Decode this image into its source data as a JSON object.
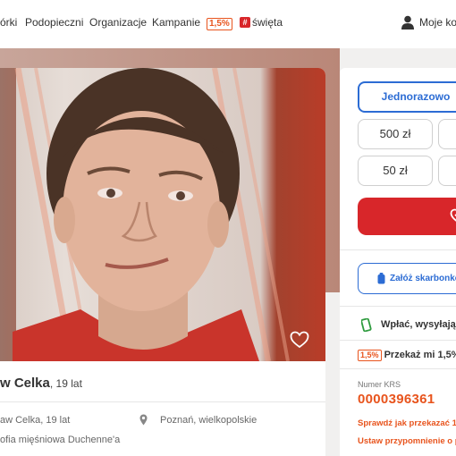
{
  "nav": {
    "items": [
      "órki",
      "Podopieczni",
      "Organizacje",
      "Kampanie"
    ],
    "badge": "1,5%",
    "holidays": "święta",
    "account": "Moje kon"
  },
  "beneficiary": {
    "name": "w Celka",
    "age": ", 19 lat",
    "detail_name": "aw Celka, 19 lat",
    "location": "Poznań, wielkopolskie",
    "diagnosis": "ofia mięśniowa Duchenne'a"
  },
  "donation": {
    "frequency_label": "Jednorazowo",
    "amounts": [
      "500 zł",
      "50 zł"
    ],
    "piggybank_label": "Załóż skarbonkę",
    "sms_label": "Wpłać, wysyłają",
    "tax_label": "Przekaż mi 1,5%",
    "tax_badge": "1,5%",
    "krs_label": "Numer KRS",
    "krs_number": "0000396361",
    "check_label": "Sprawdź jak przekazać 1,",
    "reminder_label": "Ustaw przypomnienie o p"
  },
  "colors": {
    "accent_blue": "#2c6cd4",
    "donate_red": "#d8262a",
    "krs_orange": "#e8541d"
  },
  "icons": [
    "user-icon",
    "heart-icon",
    "pin-icon",
    "donate-heart-icon",
    "piggybank-icon",
    "phone-icon"
  ]
}
